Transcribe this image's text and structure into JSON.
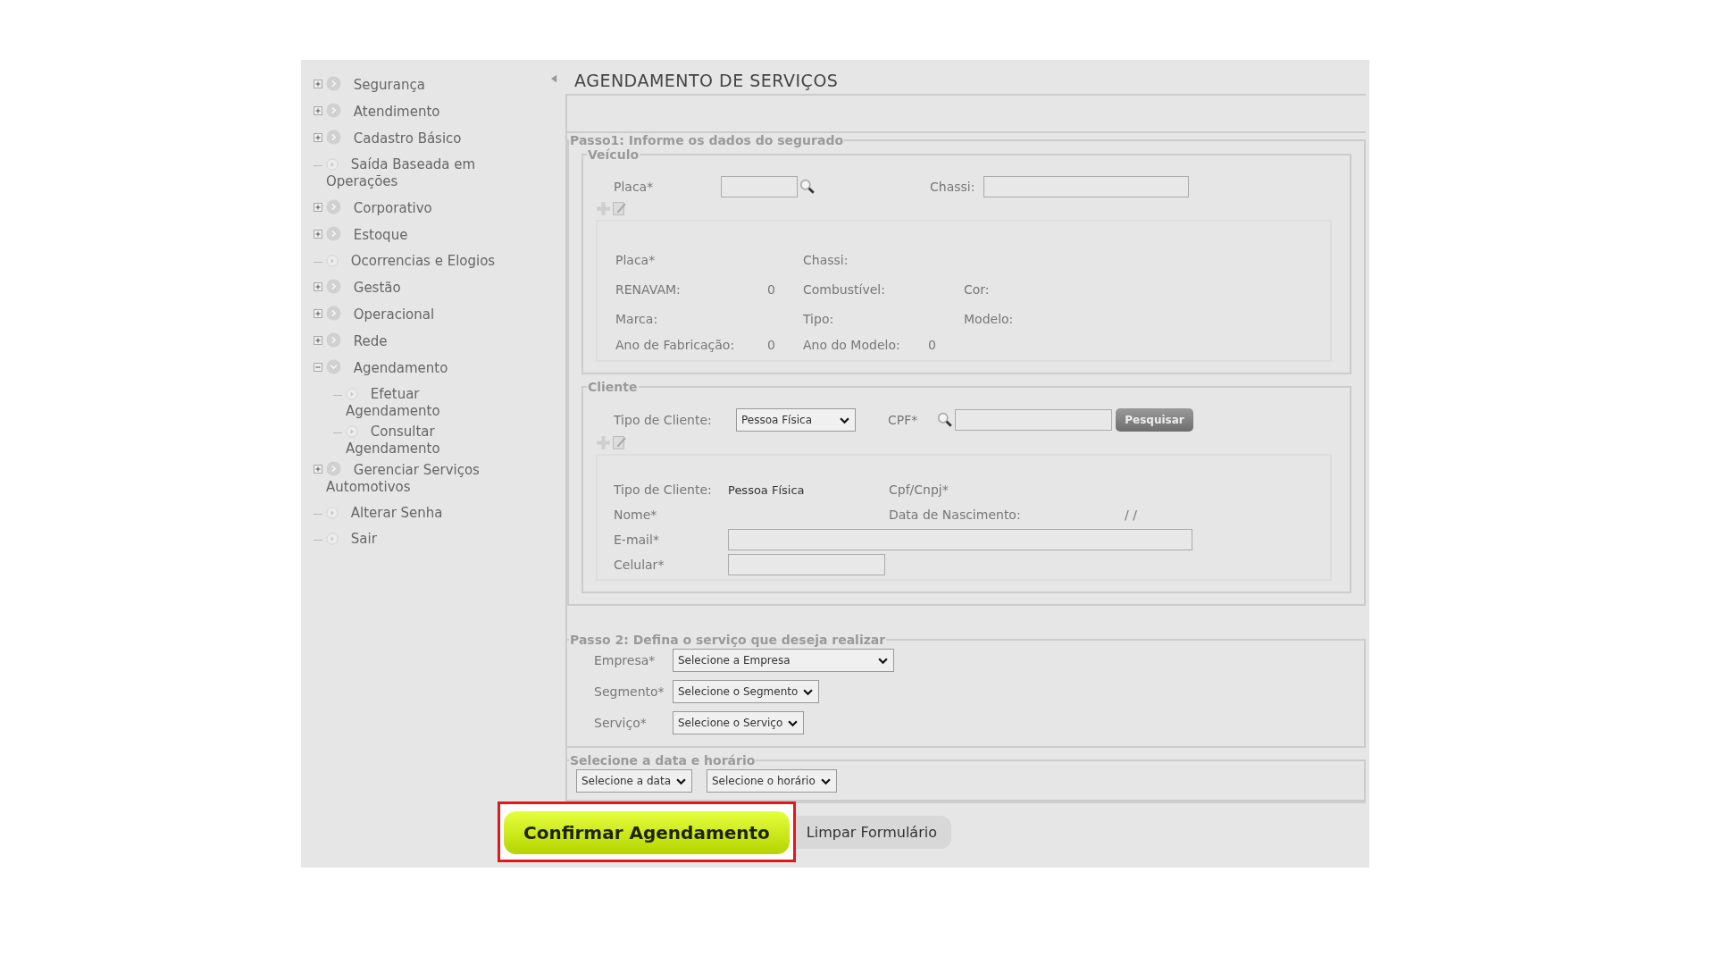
{
  "sidebar": {
    "items": [
      {
        "label": "Segurança",
        "expanded": false
      },
      {
        "label": "Atendimento",
        "expanded": false
      },
      {
        "label": "Cadastro Básico",
        "expanded": false
      },
      {
        "label": "Saída Baseada em Operações"
      },
      {
        "label": "Corporativo",
        "expanded": false
      },
      {
        "label": "Estoque",
        "expanded": false
      },
      {
        "label": "Ocorrencias e Elogios"
      },
      {
        "label": "Gestão",
        "expanded": false
      },
      {
        "label": "Operacional",
        "expanded": false
      },
      {
        "label": "Rede",
        "expanded": false
      },
      {
        "label": "Agendamento",
        "expanded": true,
        "children": [
          {
            "label": "Efetuar Agendamento"
          },
          {
            "label": "Consultar Agendamento"
          }
        ]
      },
      {
        "label": "Gerenciar Serviços Automotivos",
        "expanded": false
      },
      {
        "label": "Alterar Senha"
      },
      {
        "label": "Sair"
      }
    ]
  },
  "page_title": "AGENDAMENTO DE SERVIÇOS",
  "step1": {
    "legend": "Passo1: Informe os dados do segurado",
    "vehicle": {
      "legend": "Veículo",
      "plate_label": "Placa*",
      "chassis_label": "Chassi:",
      "info_rows": [
        [
          {
            "label": "Placa*"
          },
          {
            "label": "Chassi:"
          }
        ],
        [
          {
            "label": "RENAVAM:",
            "value": "0"
          },
          {
            "label": "Combustível:"
          },
          {
            "label": "Cor:"
          }
        ],
        [
          {
            "label": "Marca:"
          },
          {
            "label": "Tipo:"
          },
          {
            "label": "Modelo:"
          }
        ],
        [
          {
            "label": "Ano de Fabricação:",
            "value": "0"
          },
          {
            "label": "Ano do Modelo:",
            "value": "0"
          }
        ]
      ]
    },
    "client": {
      "legend": "Cliente",
      "type_label": "Tipo de Cliente:",
      "type_value": "Pessoa Física",
      "cpf_label": "CPF*",
      "search_button": "Pesquisar",
      "info": {
        "type_label": "Tipo de Cliente:",
        "type_value": "Pessoa Física",
        "doc_label": "Cpf/Cnpj*",
        "name_label": "Nome*",
        "birth_label": "Data de Nascimento:",
        "birth_value": "/ /",
        "email_label": "E-mail*",
        "phone_label": "Celular*"
      }
    }
  },
  "step2": {
    "legend": "Passo 2: Defina o serviço que deseja realizar",
    "fields": [
      {
        "label": "Empresa*",
        "value": "Selecione a Empresa"
      },
      {
        "label": "Segmento*",
        "value": "Selecione o Segmento"
      },
      {
        "label": "Serviço*",
        "value": "Selecione o Serviço"
      }
    ]
  },
  "schedule": {
    "legend": "Selecione a data e horário",
    "date": "Selecione a data",
    "time": "Selecione o horário"
  },
  "buttons": [
    {
      "label": "Confirmar Agendamento",
      "kind": "primary",
      "highlighted": true
    },
    {
      "label": "Limpar Formulário",
      "kind": "secondary",
      "highlighted": false
    }
  ]
}
